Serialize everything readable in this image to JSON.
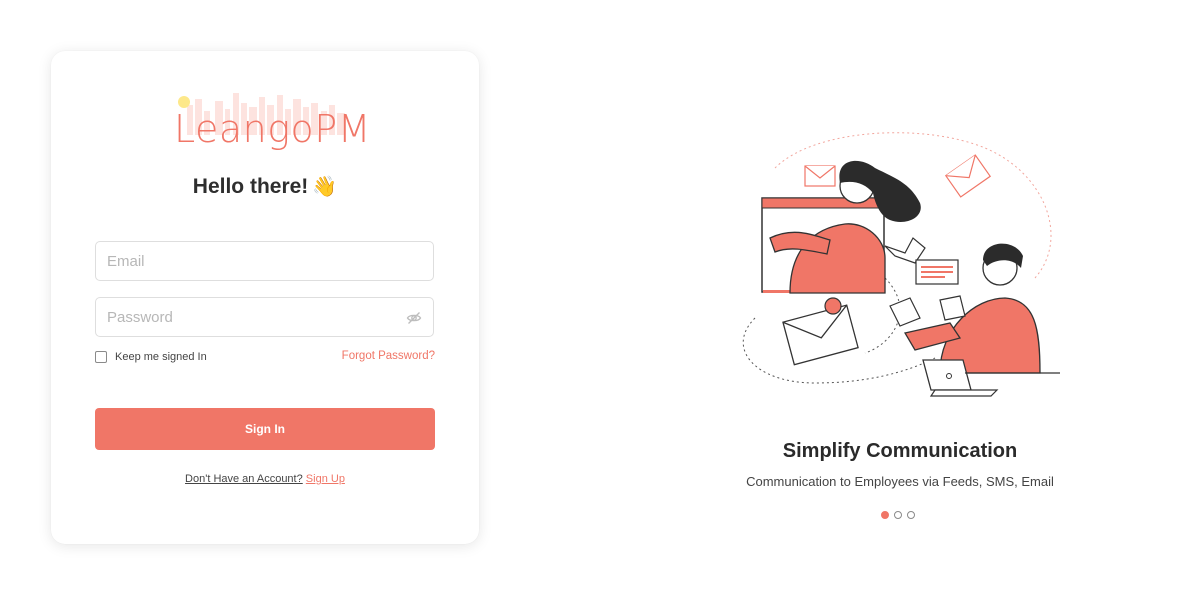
{
  "brand": {
    "logo_text": "LeangoPM",
    "accent_color": "#f07667"
  },
  "login": {
    "greeting": "Hello there!",
    "greeting_emoji": "👋",
    "email_placeholder": "Email",
    "password_placeholder": "Password",
    "keep_signed_in_label": "Keep me signed In",
    "forgot_password_label": "Forgot Password?",
    "sign_in_label": "Sign In",
    "no_account_text": "Don't Have an Account?",
    "sign_up_label": "Sign Up"
  },
  "carousel": {
    "title": "Simplify Communication",
    "subtitle": "Communication to Employees via Feeds, SMS, Email",
    "slide_count": 3,
    "active_slide": 1
  },
  "icons": {
    "password_toggle": "eye-off-icon"
  }
}
